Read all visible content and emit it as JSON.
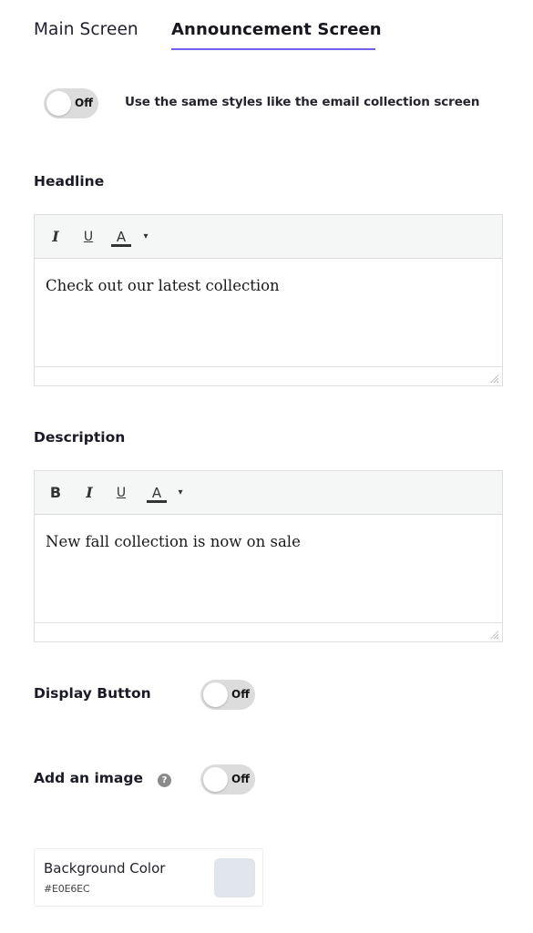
{
  "tabs": {
    "main": "Main Screen",
    "announcement": "Announcement Screen",
    "active": "announcement"
  },
  "same_styles": {
    "toggle_state": "Off",
    "label": "Use the same styles like the email collection screen"
  },
  "headline": {
    "label": "Headline",
    "toolbar": {
      "italic": "I",
      "underline": "U",
      "color": "A",
      "caret": "▾"
    },
    "content": "Check out our latest collection"
  },
  "description": {
    "label": "Description",
    "toolbar": {
      "bold": "B",
      "italic": "I",
      "underline": "U",
      "color": "A",
      "caret": "▾"
    },
    "content": "New fall collection is now on sale"
  },
  "display_button": {
    "label": "Display Button",
    "toggle_state": "Off"
  },
  "add_image": {
    "label": "Add an image",
    "help_icon_glyph": "?",
    "toggle_state": "Off"
  },
  "background_color": {
    "label": "Background Color",
    "hex": "#E0E6EC",
    "swatch_color": "#E0E6EC"
  },
  "colors": {
    "accent": "#6D63E6",
    "toggle_off_bg": "#DCDCDC"
  }
}
